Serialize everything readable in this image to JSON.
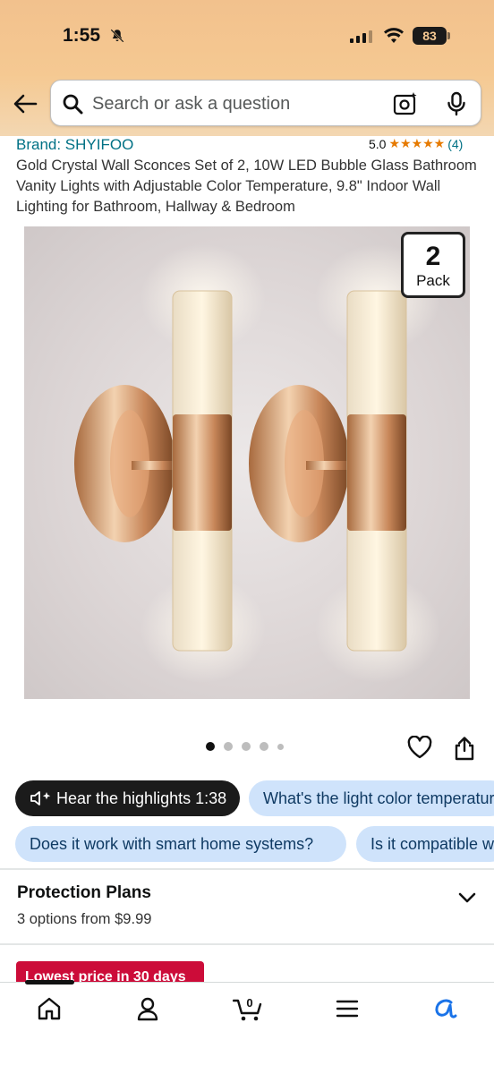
{
  "status_bar": {
    "time": "1:55",
    "battery": "83"
  },
  "search": {
    "placeholder": "Search or ask a question"
  },
  "product": {
    "brand": "Brand: SHYIFOO",
    "rating_value": "5.0",
    "stars": "★★★★★",
    "rating_count": "(4)",
    "title": "Gold Crystal Wall Sconces Set of 2, 10W LED Bubble Glass Bathroom Vanity Lights with Adjustable Color Temperature, 9.8\" Indoor Wall Lighting for Bathroom, Hallway & Bedroom",
    "pack_number": "2",
    "pack_label": "Pack"
  },
  "carousel": {
    "image_count": 5,
    "active_index": 0
  },
  "chips": {
    "hear_highlights": "Hear the highlights 1:38",
    "q1": "What's the light color temperature?",
    "q2": "Does it work with smart home systems?",
    "q3": "Is it compatible with dimmers?"
  },
  "protection": {
    "title": "Protection Plans",
    "subtitle": "3 options from $9.99"
  },
  "deal": {
    "label": "Lowest price in 30 days"
  },
  "cart": {
    "count": "0"
  },
  "colors": {
    "accent_link": "#007185",
    "star": "#e67a00",
    "chip_blue": "#cfe3fb",
    "deal_red": "#cc0c39",
    "header": "#f5c992"
  },
  "icons": [
    "bell-off-icon",
    "signal-icon",
    "wifi-icon",
    "back-arrow-icon",
    "search-icon",
    "camera-icon",
    "mic-icon",
    "heart-icon",
    "share-icon",
    "speaker-icon",
    "chevron-down-icon",
    "home-icon",
    "account-icon",
    "cart-icon",
    "menu-icon",
    "rufus-icon"
  ]
}
